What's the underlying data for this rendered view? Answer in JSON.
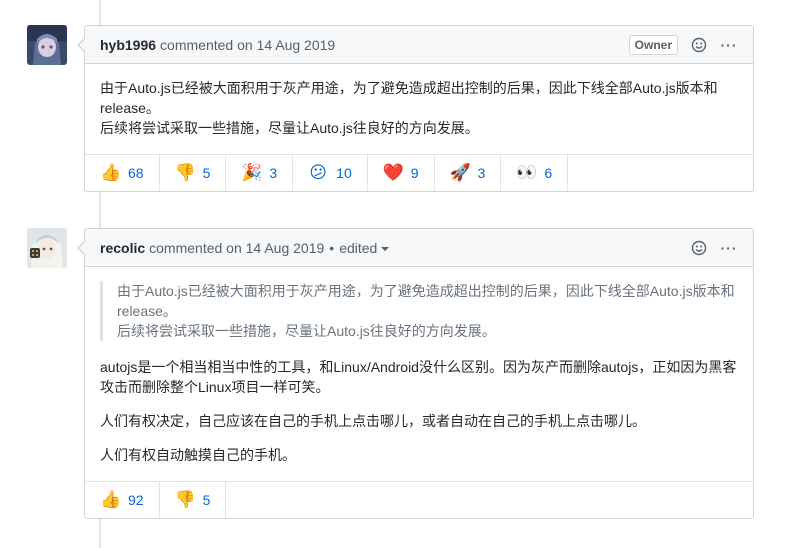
{
  "comments": [
    {
      "author": "hyb1996",
      "meta": "commented on 14 Aug 2019",
      "badge": "Owner",
      "body": [
        "由于Auto.js已经被大面积用于灰产用途，为了避免造成超出控制的后果，因此下线全部Auto.js版本和release。",
        "后续将尝试采取一些措施，尽量让Auto.js往良好的方向发展。"
      ],
      "reactions": [
        {
          "emoji": "👍",
          "icon": "thumbs-up-icon",
          "count": "68"
        },
        {
          "emoji": "👎",
          "icon": "thumbs-down-icon",
          "count": "5"
        },
        {
          "emoji": "🎉",
          "icon": "hooray-icon",
          "count": "3"
        },
        {
          "emoji": "😕",
          "icon": "confused-icon",
          "count": "10"
        },
        {
          "emoji": "❤️",
          "icon": "heart-icon",
          "count": "9"
        },
        {
          "emoji": "🚀",
          "icon": "rocket-icon",
          "count": "3"
        },
        {
          "emoji": "👀",
          "icon": "eyes-icon",
          "count": "6"
        }
      ]
    },
    {
      "author": "recolic",
      "meta": "commented on 14 Aug 2019",
      "edited": "edited",
      "quote": [
        "由于Auto.js已经被大面积用于灰产用途，为了避免造成超出控制的后果，因此下线全部Auto.js版本和release。",
        "后续将尝试采取一些措施，尽量让Auto.js往良好的方向发展。"
      ],
      "body": [
        "autojs是一个相当相当中性的工具，和Linux/Android没什么区别。因为灰产而删除autojs，正如因为黑客攻击而删除整个Linux项目一样可笑。",
        "人们有权决定，自己应该在自己的手机上点击哪儿，或者自动在自己的手机上点击哪儿。",
        "人们有权自动触摸自己的手机。"
      ],
      "reactions": [
        {
          "emoji": "👍",
          "icon": "thumbs-up-icon",
          "count": "92"
        },
        {
          "emoji": "👎",
          "icon": "thumbs-down-icon",
          "count": "5"
        }
      ]
    }
  ]
}
